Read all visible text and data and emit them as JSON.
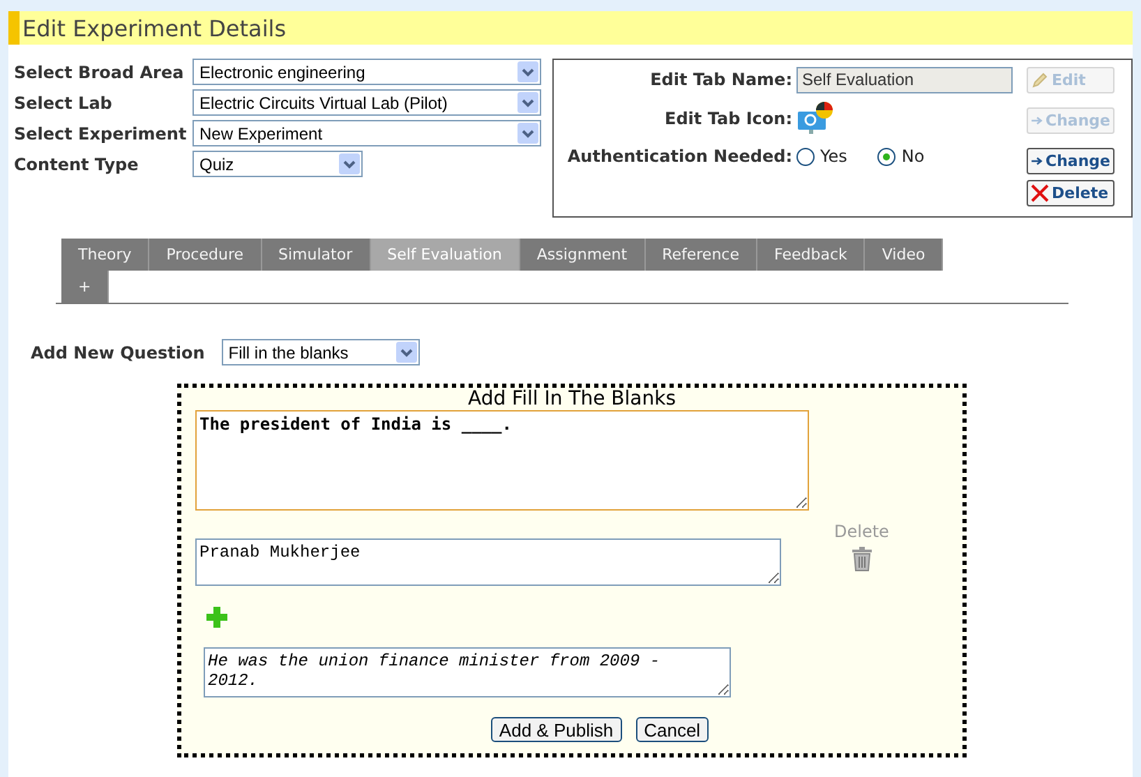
{
  "header": {
    "title": "Edit Experiment Details"
  },
  "form": [
    {
      "label": "Select Broad Area",
      "value": "Electronic engineering",
      "wide": true
    },
    {
      "label": "Select Lab",
      "value": "Electric Circuits Virtual Lab (Pilot)",
      "wide": true
    },
    {
      "label": "Select Experiment",
      "value": "New Experiment",
      "wide": true
    },
    {
      "label": "Content Type",
      "value": "Quiz",
      "wide": false
    }
  ],
  "tab_panel": {
    "name_label": "Edit Tab Name:",
    "name_value": "Self Evaluation",
    "icon_label": "Edit Tab Icon:",
    "auth_label": "Authentication Needed:",
    "auth_options": [
      {
        "label": "Yes",
        "selected": false
      },
      {
        "label": "No",
        "selected": true
      }
    ],
    "buttons": [
      {
        "label": "Edit",
        "kind": "edit",
        "disabled": true
      },
      {
        "label": "Change",
        "kind": "change",
        "disabled": true
      },
      {
        "label": "Change",
        "kind": "change",
        "disabled": false
      },
      {
        "label": "Delete",
        "kind": "delete",
        "disabled": false
      }
    ]
  },
  "tabs": [
    {
      "label": "Theory",
      "selected": false
    },
    {
      "label": "Procedure",
      "selected": false
    },
    {
      "label": "Simulator",
      "selected": false
    },
    {
      "label": "Self Evaluation",
      "selected": true
    },
    {
      "label": "Assignment",
      "selected": false
    },
    {
      "label": "Reference",
      "selected": false
    },
    {
      "label": "Feedback",
      "selected": false
    },
    {
      "label": "Video",
      "selected": false
    },
    {
      "label": "+",
      "selected": false
    }
  ],
  "add_question": {
    "label": "Add New Question",
    "value": "Fill in the blanks"
  },
  "editor": {
    "title": "Add Fill In The Blanks",
    "question": {
      "value": "The president of India is ____."
    },
    "answer": {
      "value": "Pranab Mukherjee"
    },
    "delete_label": "Delete",
    "hint": {
      "value": "He was the union finance minister from 2009 - 2012."
    },
    "buttons": [
      "Add & Publish",
      "Cancel"
    ]
  }
}
